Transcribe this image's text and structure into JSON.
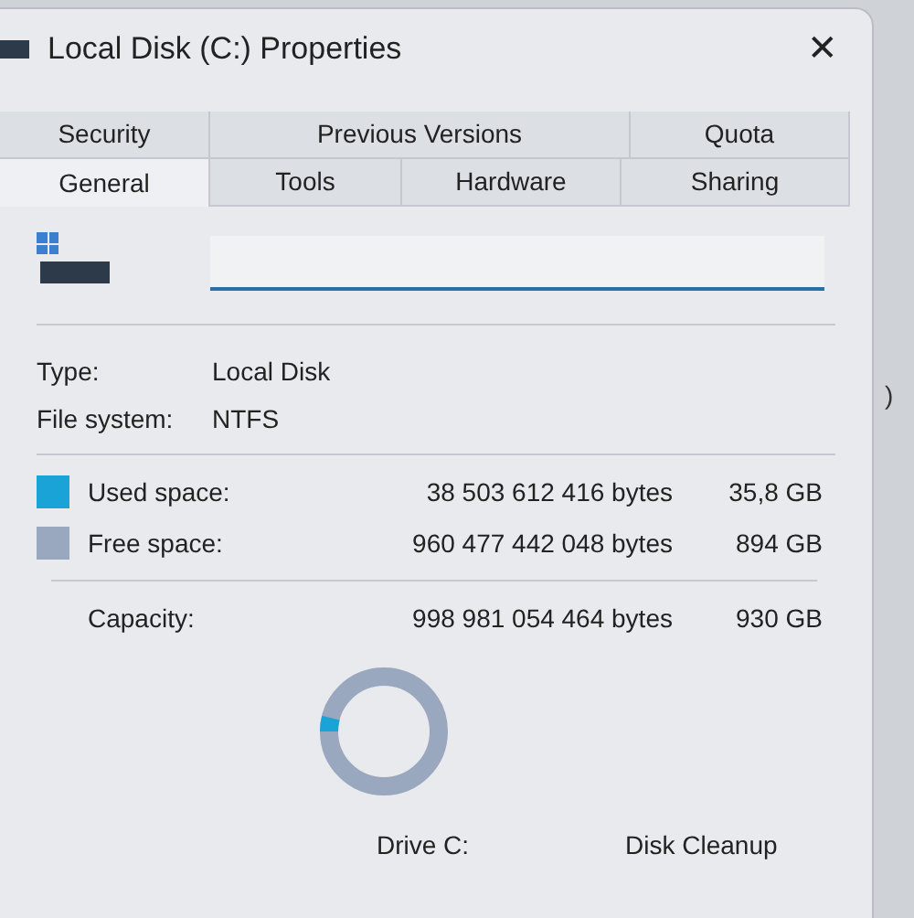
{
  "window": {
    "title": "Local Disk (C:) Properties",
    "close": "✕"
  },
  "tabs": [
    [
      {
        "label": "Security",
        "selected": false
      },
      {
        "label": "Previous Versions",
        "selected": false
      },
      {
        "label": "Quota",
        "selected": false
      }
    ],
    [
      {
        "label": "General",
        "selected": true
      },
      {
        "label": "Tools",
        "selected": false
      },
      {
        "label": "Hardware",
        "selected": false
      },
      {
        "label": "Sharing",
        "selected": false
      }
    ]
  ],
  "name_field": {
    "focused": true
  },
  "info": [
    {
      "label": "Type:",
      "value": "Local Disk"
    },
    {
      "label": "File system:",
      "value": "NTFS"
    }
  ],
  "space": [
    {
      "label": "Used space:",
      "bytes": "38 503 612 416 bytes",
      "size": "35,8 GB",
      "color": "#1aa3d6"
    },
    {
      "label": "Free space:",
      "bytes": "960 477 442 048 bytes",
      "size": "894 GB",
      "color": "#9aa8bf"
    }
  ],
  "capacity": {
    "label": "Capacity:",
    "bytes": "998 981 054 464 bytes",
    "size": "930 GB"
  },
  "usage": {
    "level": 0.04
  },
  "drive_label": "Drive C:",
  "cleanup_button": "Disk Cleanup",
  "background_text": ")"
}
